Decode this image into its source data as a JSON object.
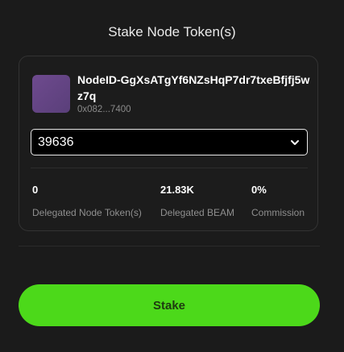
{
  "dialog": {
    "title": "Stake Node Token(s)"
  },
  "node": {
    "name": "NodeID-GgXsATgYf6NZsHqP7dr7txeBfjfj5wz7q",
    "address": "0x082...7400"
  },
  "token_select": {
    "selected": "39636"
  },
  "stats": [
    {
      "value": "0",
      "label": "Delegated Node Token(s)"
    },
    {
      "value": "21.83K",
      "label": "Delegated BEAM"
    },
    {
      "value": "0%",
      "label": "Commission"
    }
  ],
  "actions": {
    "stake_label": "Stake"
  },
  "colors": {
    "accent": "#4cd91a",
    "background": "#1b1b1b"
  },
  "icons": {
    "avatar": "node-avatar",
    "select": "chevron-down-icon"
  }
}
